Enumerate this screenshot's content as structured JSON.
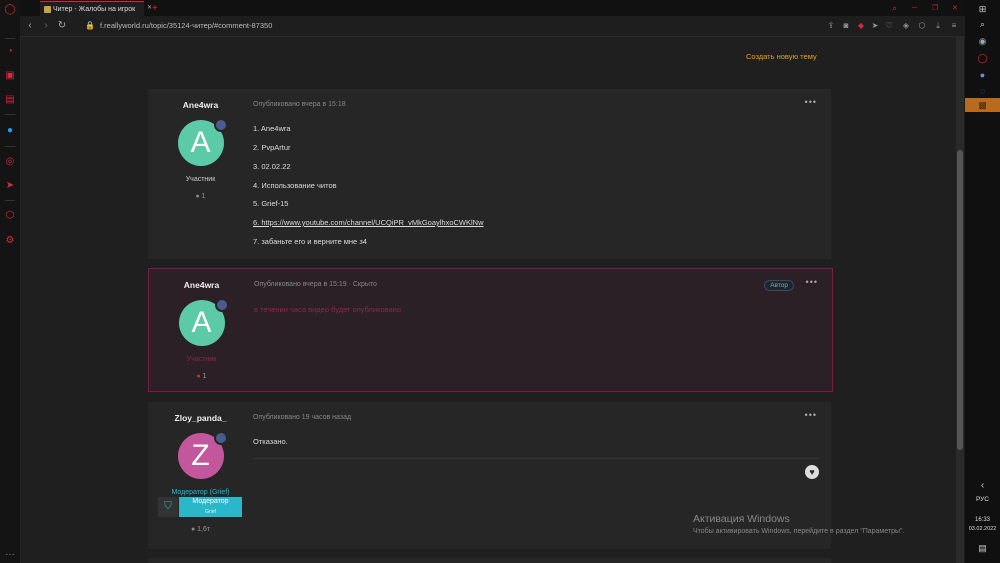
{
  "browser": {
    "tab_title": "Читер - Жалобы на игрок",
    "url": "f.reallyworld.ru/topic/35124-читер/#comment-87350",
    "new_tab": "+"
  },
  "page": {
    "create_topic": "Создать новую тему"
  },
  "posts": [
    {
      "author": "Ane4wra",
      "avatar_letter": "A",
      "avatar_color": "#5cc9a7",
      "group": "Участник",
      "count": "1",
      "meta": "Опубликовано вчера в 15:18",
      "lines": [
        "1. Ane4wra",
        "2. PvpArtur",
        "3. 02.02.22",
        "4. Использование читов",
        "5. Grief-15",
        "6. https://www.youtube.com/channel/UCQiPR_vMkGoaylhxoCWKlNw",
        "7. забаньте его и верните мне з4"
      ]
    },
    {
      "author": "Ane4wra",
      "avatar_letter": "A",
      "avatar_color": "#5cc9a7",
      "group": "Участник",
      "count": "1",
      "meta": "Опубликовано вчера в 15:19 · Скрыто",
      "tag": "Автор",
      "text": "в течении часа видео будет опубликовано"
    },
    {
      "author": "Zloy_panda_",
      "avatar_letter": "Z",
      "avatar_color": "#c2579e",
      "group": "Модератор (Grief)",
      "badge_label": "Модератор",
      "badge_sub": "Grief",
      "count": "1,6т",
      "meta": "Опубликовано 19 часов назад",
      "text": "Отказано."
    }
  ],
  "windows": {
    "activate_title": "Активация Windows",
    "activate_sub": "Чтобы активировать Windows, перейдите в раздел \"Параметры\".",
    "lang": "РУС",
    "time": "16:33",
    "date": "03.02.2022"
  },
  "colors": {
    "accent_red": "#d9263f",
    "link_orange": "#e6a21b",
    "moderator_cyan": "#2ab7c9",
    "hidden_border": "#7a1d3f",
    "hidden_text": "#8a2a4a"
  }
}
